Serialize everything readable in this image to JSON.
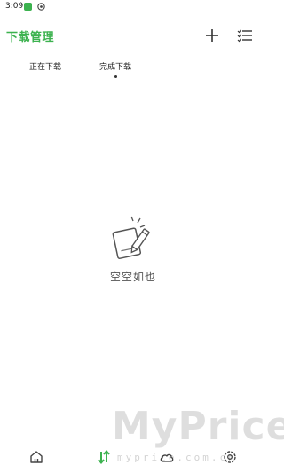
{
  "status_bar": {
    "time": "3:09",
    "app_icon": "green-app-icon",
    "settings_icon": "gear-icon"
  },
  "header": {
    "title": "下载管理",
    "add_icon": "plus-icon",
    "list_icon": "checklist-icon"
  },
  "tabs": [
    {
      "label": "正在下载",
      "active": false
    },
    {
      "label": "完成下载",
      "active": true
    }
  ],
  "empty_state": {
    "icon": "empty-note-pencil-icon",
    "text": "空空如也"
  },
  "bottom_nav": [
    {
      "icon": "home-icon",
      "active": false
    },
    {
      "icon": "transfer-icon",
      "active": true
    },
    {
      "icon": "cloud-icon",
      "active": false
    },
    {
      "icon": "settings-icon",
      "active": false
    }
  ],
  "watermark": {
    "logo": "MyPrice",
    "url": "myprice.com.cn"
  },
  "colors": {
    "accent": "#3cb24f",
    "text": "#222222",
    "muted": "#555555",
    "background": "#ffffff"
  }
}
